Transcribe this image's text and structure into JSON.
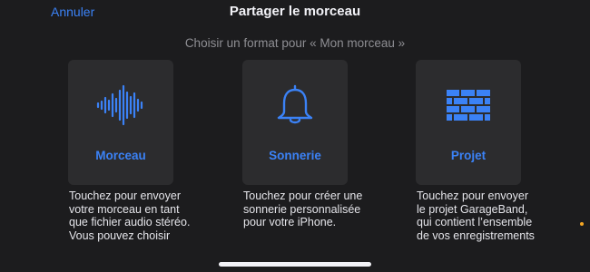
{
  "header": {
    "cancel_label": "Annuler",
    "title": "Partager le morceau"
  },
  "subtitle": "Choisir un format pour « Mon morceau »",
  "options": [
    {
      "label": "Morceau",
      "icon": "waveform-icon",
      "description": "Touchez pour envoyer votre morceau en tant que fichier audio stéréo. Vous pouvez choisir"
    },
    {
      "label": "Sonnerie",
      "icon": "bell-icon",
      "description": "Touchez pour créer une sonnerie personnalisée pour votre iPhone."
    },
    {
      "label": "Projet",
      "icon": "brick-wall-icon",
      "description": "Touchez pour envoyer le projet GarageBand, qui contient l’ensemble de vos enregistrements"
    }
  ],
  "colors": {
    "accent": "#3b82f6",
    "background": "#1c1c1e",
    "card": "#2c2c2e",
    "secondary_text": "#8e8e93"
  }
}
